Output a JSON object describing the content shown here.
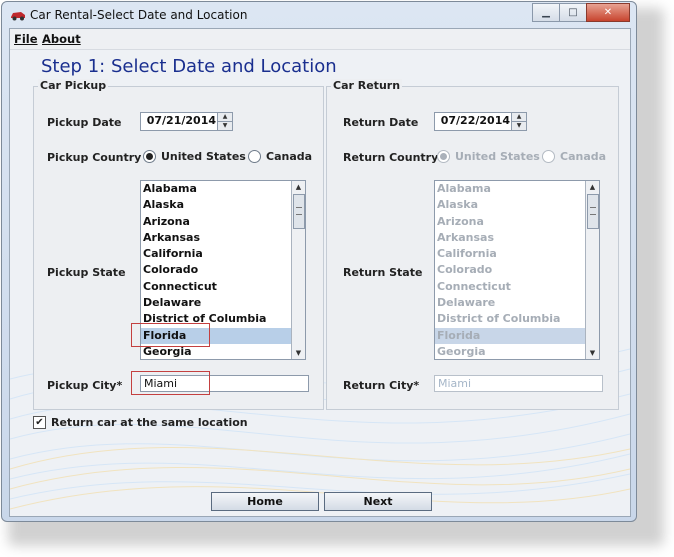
{
  "window": {
    "title": "Car Rental-Select Date and Location",
    "minimize_symbol": "▁",
    "maximize_symbol": "□",
    "close_symbol": "✕"
  },
  "menu": {
    "file_label": "File",
    "about_label": "About"
  },
  "page_title": "Step 1: Select Date and Location",
  "pickup": {
    "legend": "Car Pickup",
    "date_label": "Pickup Date",
    "date_value": "07/21/2014",
    "country_label": "Pickup Country",
    "country_options": [
      "United States",
      "Canada"
    ],
    "country_selected": "United States",
    "state_label": "Pickup State",
    "states": [
      "Alabama",
      "Alaska",
      "Arizona",
      "Arkansas",
      "California",
      "Colorado",
      "Connecticut",
      "Delaware",
      "District of Columbia",
      "Florida",
      "Georgia"
    ],
    "state_selected": "Florida",
    "city_label": "Pickup City*",
    "city_value": "Miami"
  },
  "return": {
    "legend": "Car Return",
    "date_label": "Return Date",
    "date_value": "07/22/2014",
    "country_label": "Return Country",
    "country_options": [
      "United States",
      "Canada"
    ],
    "country_selected": "United States",
    "state_label": "Return State",
    "states": [
      "Alabama",
      "Alaska",
      "Arizona",
      "Arkansas",
      "California",
      "Colorado",
      "Connecticut",
      "Delaware",
      "District of Columbia",
      "Florida",
      "Georgia"
    ],
    "state_selected": "Florida",
    "city_label": "Return City*",
    "city_value": "Miami"
  },
  "same_location_label": "Return car at the same location",
  "same_location_checked": true,
  "checkbox_mark": "✔",
  "buttons": {
    "home_label": "Home",
    "next_label": "Next"
  },
  "colors": {
    "title_blue": "#1a2f8f",
    "highlight_red": "#c44040",
    "selection": "#b8cfe8"
  }
}
